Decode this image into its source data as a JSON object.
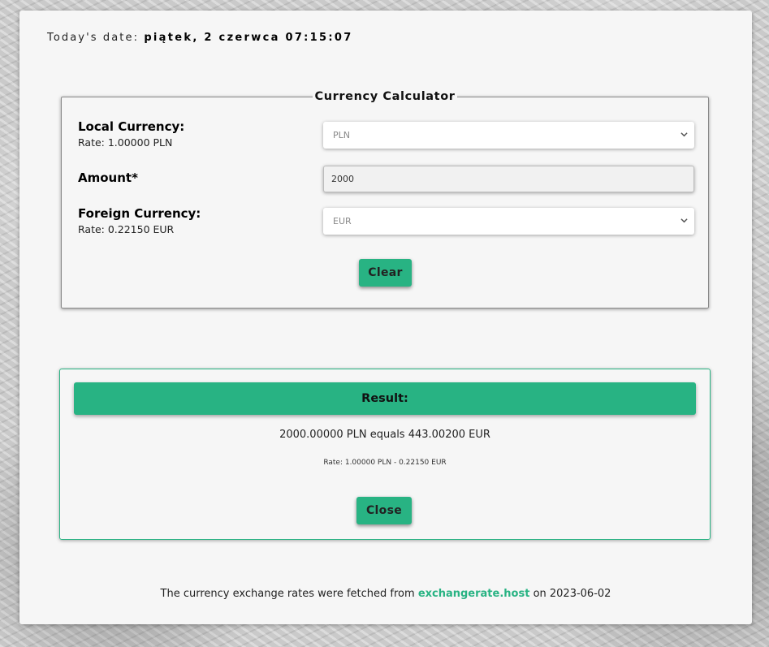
{
  "header": {
    "date_label": "Today's date:",
    "date_value": "piątek, 2 czerwca 07:15:07"
  },
  "calculator": {
    "title": "Currency Calculator",
    "local": {
      "label": "Local Currency:",
      "rate": "Rate: 1.00000 PLN",
      "selected": "PLN"
    },
    "amount": {
      "label": "Amount*",
      "value": "2000"
    },
    "foreign": {
      "label": "Foreign Currency:",
      "rate": "Rate: 0.22150 EUR",
      "selected": "EUR"
    },
    "clear_label": "Clear"
  },
  "result": {
    "title": "Result:",
    "main": "2000.00000 PLN equals 443.00200 EUR",
    "rate": "Rate: 1.00000 PLN - 0.22150 EUR",
    "close_label": "Close"
  },
  "footer": {
    "prefix": "The currency exchange rates were fetched from",
    "link": "exchangerate.host",
    "suffix": "on 2023-06-02"
  },
  "colors": {
    "accent": "#28b383",
    "card": "#f6f6f6"
  },
  "icons": {
    "select_arrow": "chevron-down-icon"
  }
}
